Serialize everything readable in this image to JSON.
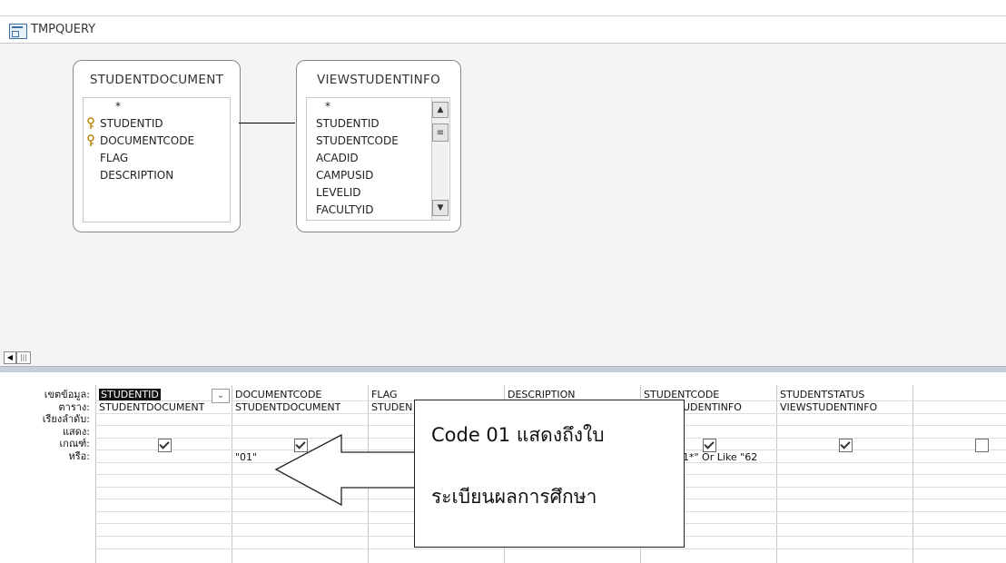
{
  "window": {
    "title": "TMPQUERY",
    "icon": "query-icon"
  },
  "tables": [
    {
      "name": "STUDENTDOCUMENT",
      "fields": [
        {
          "label": "*",
          "key": false
        },
        {
          "label": "STUDENTID",
          "key": true
        },
        {
          "label": "DOCUMENTCODE",
          "key": true
        },
        {
          "label": "FLAG",
          "key": false
        },
        {
          "label": "DESCRIPTION",
          "key": false
        }
      ]
    },
    {
      "name": "VIEWSTUDENTINFO",
      "fields": [
        {
          "label": "*"
        },
        {
          "label": "STUDENTID"
        },
        {
          "label": "STUDENTCODE"
        },
        {
          "label": "ACADID"
        },
        {
          "label": "CAMPUSID"
        },
        {
          "label": "LEVELID"
        },
        {
          "label": "FACULTYID"
        }
      ]
    }
  ],
  "grid": {
    "row_labels": [
      "เขตข้อมูล:",
      "ตาราง:",
      "เรียงลำดับ:",
      "แสดง:",
      "เกณฑ์:",
      "หรือ:"
    ],
    "columns": [
      {
        "field": "STUDENTID",
        "table": "STUDENTDOCUMENT",
        "show": true,
        "criteria": ""
      },
      {
        "field": "DOCUMENTCODE",
        "table": "STUDENTDOCUMENT",
        "show": true,
        "criteria": "\"01\""
      },
      {
        "field": "FLAG",
        "table": "STUDEN",
        "show": true,
        "criteria": ""
      },
      {
        "field": "DESCRIPTION",
        "table": "",
        "show": true,
        "criteria": ""
      },
      {
        "field": "STUDENTCODE",
        "table": "UDENTINFO",
        "show": true,
        "criteria": "1*\" Or Like \"62"
      },
      {
        "field": "STUDENTSTATUS",
        "table": "VIEWSTUDENTINFO",
        "show": true,
        "criteria": ""
      },
      {
        "field": "",
        "table": "",
        "show": false,
        "criteria": ""
      }
    ]
  },
  "callout": {
    "line1": "Code 01 แสดงถึงใบ",
    "line2": "ระเบียนผลการศึกษา"
  }
}
